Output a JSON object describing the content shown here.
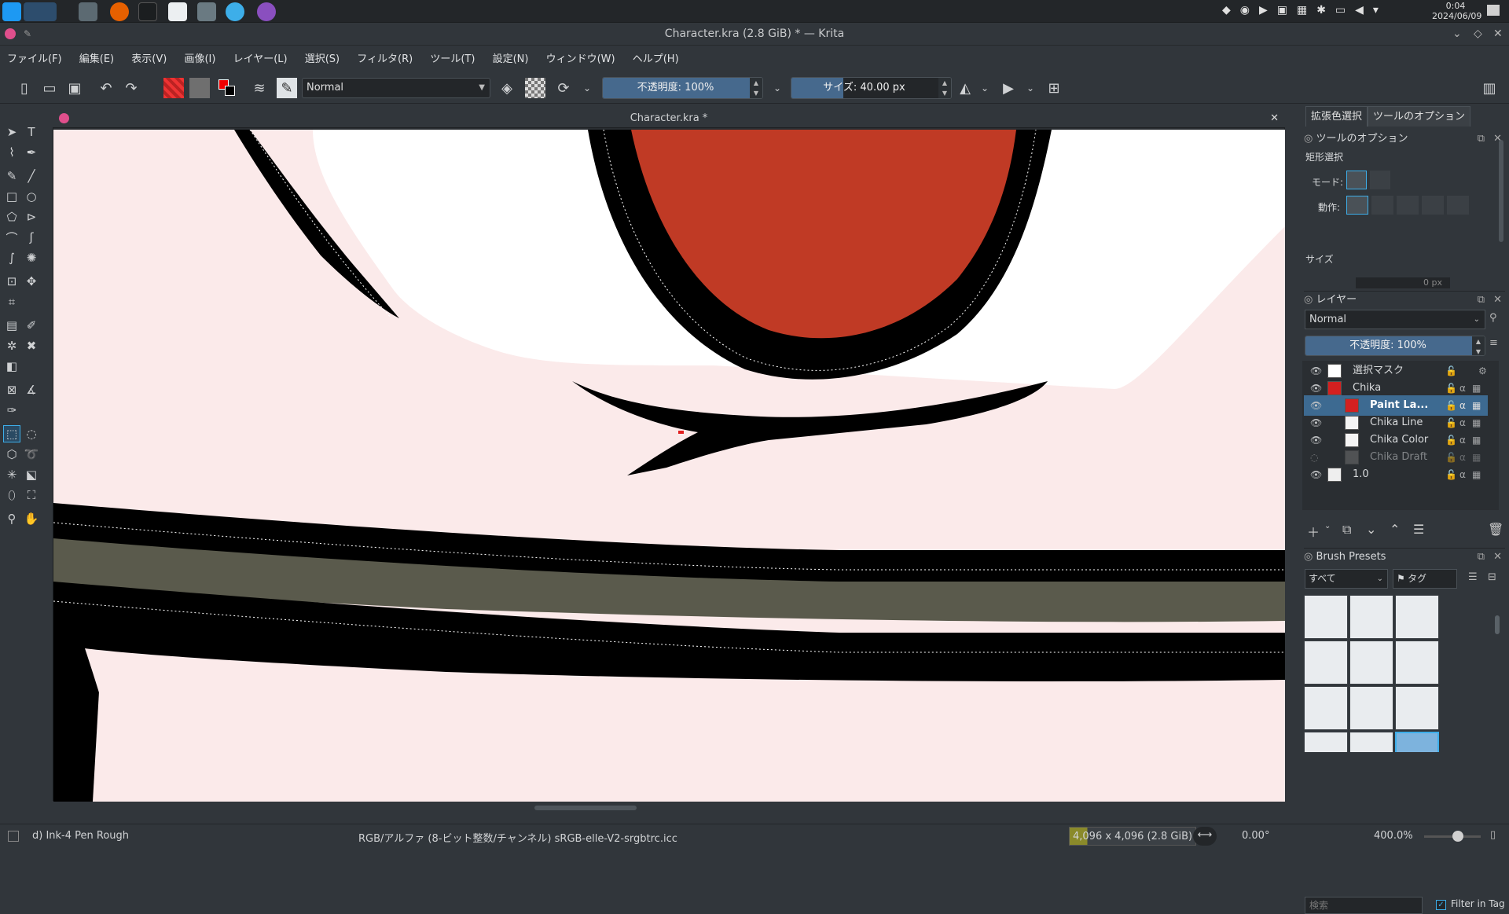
{
  "taskbar": {
    "time": "0:04",
    "date": "2024/06/09"
  },
  "window": {
    "title": "Character.kra (2.8 GiB) * — Krita"
  },
  "menu": [
    "ファイル(F)",
    "編集(E)",
    "表示(V)",
    "画像(I)",
    "レイヤー(L)",
    "選択(S)",
    "フィルタ(R)",
    "ツール(T)",
    "設定(N)",
    "ウィンドウ(W)",
    "ヘルプ(H)"
  ],
  "toolbar": {
    "blend_mode": "Normal",
    "opacity_label": "不透明度: 100%",
    "opacity_value": 1.0,
    "size_label": "サイズ: 40.00 px",
    "size_fraction": 0.18
  },
  "document": {
    "tab_title": "Character.kra *"
  },
  "right_tabs": [
    "拡張色選択",
    "ツールのオプション"
  ],
  "tool_options": {
    "header": "ツールのオプション",
    "section": "矩形選択",
    "mode_label": "モード:",
    "action_label": "動作:",
    "size_label": "サイズ",
    "partial_value": "0 px"
  },
  "layers": {
    "header": "レイヤー",
    "blend_mode": "Normal",
    "opacity_label": "不透明度: 100%",
    "items": [
      {
        "name": "選択マスク",
        "visible": true
      },
      {
        "name": "Chika",
        "visible": true
      },
      {
        "name": "Paint La...",
        "visible": true,
        "selected": true
      },
      {
        "name": "Chika Line",
        "visible": true
      },
      {
        "name": "Chika Color",
        "visible": true
      },
      {
        "name": "Chika Draft",
        "visible": false
      },
      {
        "name": "1.0",
        "visible": true
      }
    ]
  },
  "brush_presets": {
    "header": "Brush Presets",
    "filter": "すべて",
    "tag_label": "タグ",
    "search_placeholder": "検索",
    "filter_in_tag": "Filter in Tag"
  },
  "status": {
    "brush_name": "d) Ink-4 Pen Rough",
    "color_space": "RGB/アルファ (8-ビット整数/チャンネル)  sRGB-elle-V2-srgbtrc.icc",
    "image_size": "4,096 x 4,096 (2.8 GiB)",
    "rotation": "0.00°",
    "zoom": "400.0%"
  }
}
